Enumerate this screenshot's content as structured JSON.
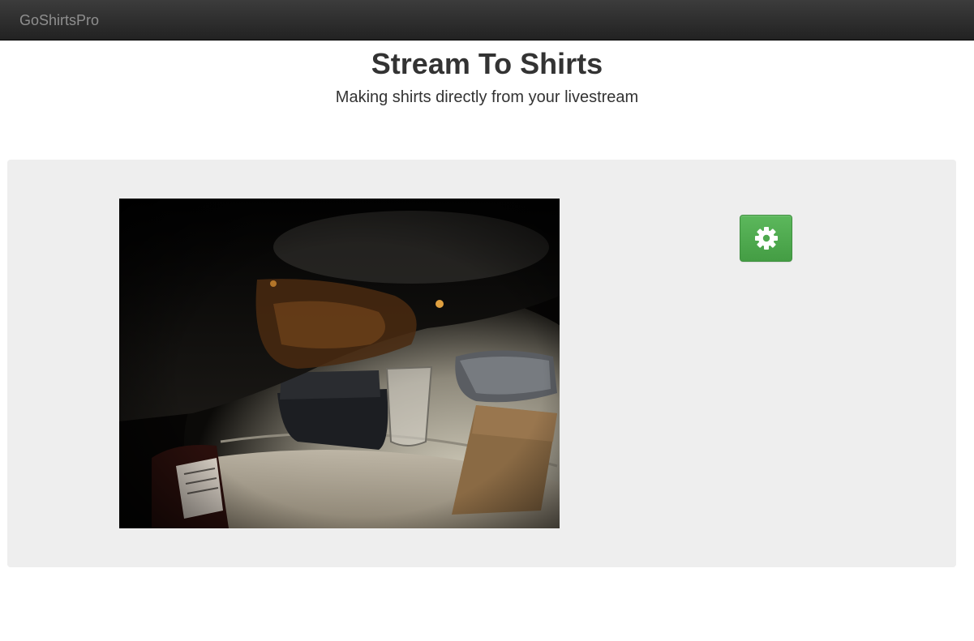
{
  "navbar": {
    "brand": "GoShirtsPro"
  },
  "header": {
    "title": "Stream To Shirts",
    "subtitle": "Making shirts directly from your livestream"
  },
  "stream": {
    "content": "livestream webcam frame"
  },
  "settings": {
    "icon": "gear-icon",
    "color": "#5cb85c"
  },
  "colors": {
    "navbar_bg": "#222222",
    "well_bg": "#eeeeee",
    "brand_text": "#8f8f8f"
  }
}
